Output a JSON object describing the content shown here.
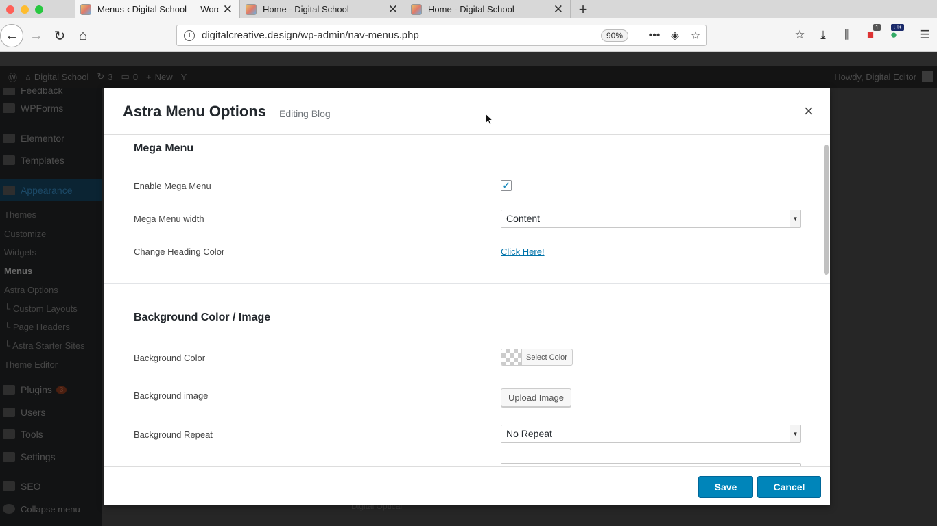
{
  "browser": {
    "tabs": [
      {
        "label": "Menus ‹ Digital School — WordPress",
        "active": true
      },
      {
        "label": "Home - Digital School",
        "active": false
      },
      {
        "label": "Home - Digital School",
        "active": false
      }
    ],
    "url": "digitalcreative.design/wp-admin/nav-menus.php",
    "zoom": "90%",
    "traffic_colors": [
      "#ff5f57",
      "#febc2e",
      "#28c840"
    ],
    "extension_badge": "1",
    "extension_label": "UK"
  },
  "admin_bar": {
    "site_name": "Digital School",
    "updates": "3",
    "comments": "0",
    "new_label": "New",
    "howdy": "Howdy, Digital Editor"
  },
  "sidebar": {
    "items": [
      {
        "label": "Feedback"
      },
      {
        "label": "WPForms"
      },
      {
        "label": "Elementor"
      },
      {
        "label": "Templates"
      },
      {
        "label": "Appearance"
      },
      {
        "label": "Plugins",
        "badge": "3"
      },
      {
        "label": "Users"
      },
      {
        "label": "Tools"
      },
      {
        "label": "Settings"
      },
      {
        "label": "SEO"
      },
      {
        "label": "Collapse menu"
      }
    ],
    "appearance_sub": [
      "Themes",
      "Customize",
      "Widgets",
      "Menus",
      "Astra Options",
      "└ Custom Layouts",
      "└ Page Headers",
      "└ Astra Starter Sites",
      "Theme Editor"
    ]
  },
  "modal": {
    "title": "Astra Menu Options",
    "subtitle": "Editing Blog",
    "close_symbol": "×",
    "sections": {
      "mega_menu": {
        "title": "Mega Menu",
        "enable_label": "Enable Mega Menu",
        "enable_checked": true,
        "width_label": "Mega Menu width",
        "width_value": "Content",
        "heading_color_label": "Change Heading Color",
        "heading_color_link": "Click Here!"
      },
      "background": {
        "title": "Background Color / Image",
        "color_label": "Background Color",
        "color_button": "Select Color",
        "image_label": "Background image",
        "image_button": "Upload Image",
        "repeat_label": "Background Repeat",
        "repeat_value": "No Repeat"
      }
    },
    "footer": {
      "save": "Save",
      "cancel": "Cancel"
    }
  },
  "background_ghost_text": "Digital Optical"
}
